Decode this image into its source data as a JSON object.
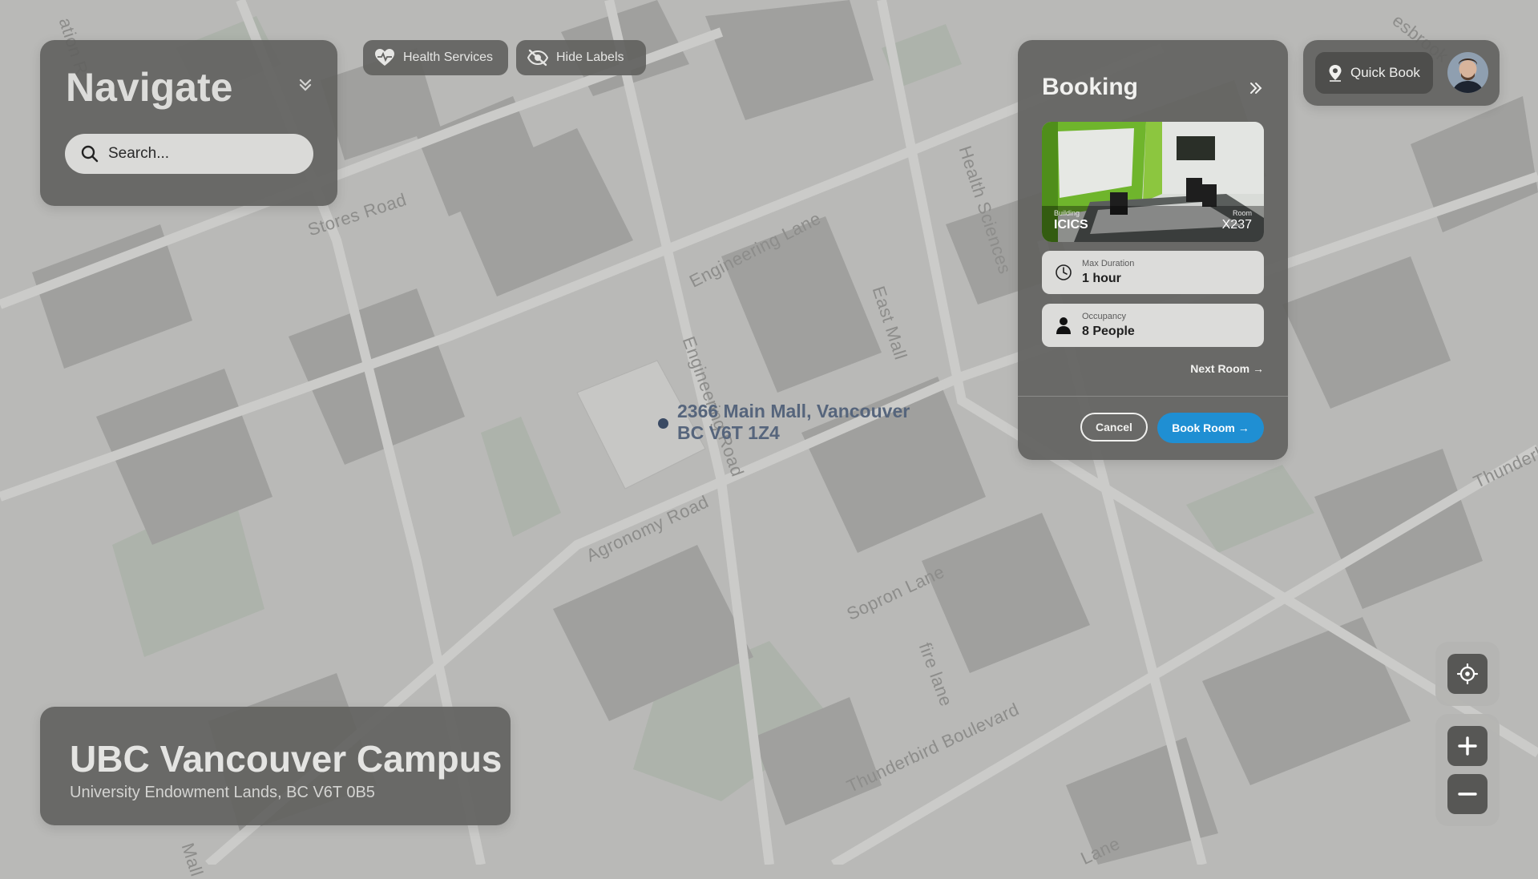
{
  "map": {
    "street_labels": [
      "Stores Road",
      "Engineering Lane",
      "Engineering Road",
      "East Mall",
      "Health Sciences",
      "Agronomy Road",
      "Sopron Lane",
      "fire lane",
      "Thunderbird Boulevard",
      "Thunderbird",
      "Lane",
      "Mall",
      "ation R",
      "esbrook"
    ],
    "marker": {
      "line1": "2366 Main Mall, Vancouver",
      "line2": "BC V6T 1Z4"
    }
  },
  "navigate": {
    "title": "Navigate",
    "search_placeholder": "Search..."
  },
  "toolbar": {
    "health_label": "Health Services",
    "labels_label": "Hide Labels"
  },
  "booking": {
    "title": "Booking",
    "building_caption": "Building",
    "building": "ICICS",
    "room_caption": "Room",
    "room": "X237",
    "duration_label": "Max Duration",
    "duration_value": "1 hour",
    "occupancy_label": "Occupancy",
    "occupancy_value": "8 People",
    "next_room": "Next Room →",
    "cancel": "Cancel",
    "book": "Book Room →"
  },
  "quick_book": {
    "label": "Quick Book"
  },
  "campus": {
    "title": "UBC Vancouver Campus",
    "subtitle": "University Endowment Lands, BC V6T 0B5"
  },
  "colors": {
    "accent": "#1f8fd3",
    "panel": "#626260"
  }
}
